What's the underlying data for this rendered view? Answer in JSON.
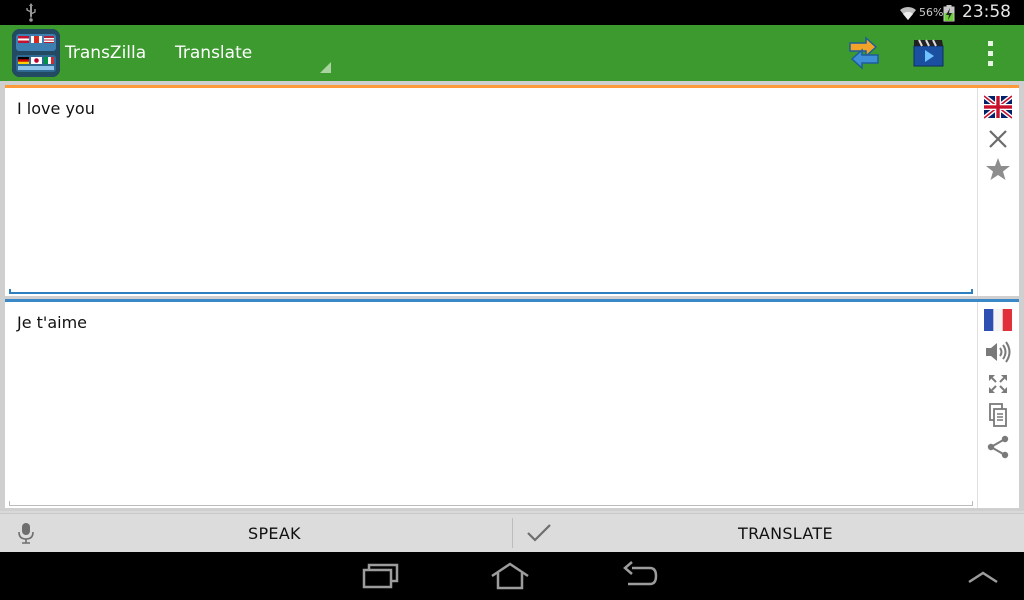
{
  "status_bar": {
    "battery_percent": "56%",
    "time": "23:58"
  },
  "action_bar": {
    "app_name": "TransZilla",
    "mode_selected": "Translate",
    "actions": [
      {
        "name": "swap-languages-icon"
      },
      {
        "name": "video-icon"
      },
      {
        "name": "overflow-menu-icon"
      }
    ]
  },
  "source": {
    "text": "I love you",
    "language_flag": "uk-flag-icon",
    "icons": [
      "uk-flag-icon",
      "clear-icon",
      "favorite-star-icon"
    ]
  },
  "target": {
    "text": "Je t'aime",
    "language_flag": "france-flag-icon",
    "icons": [
      "france-flag-icon",
      "speaker-icon",
      "fullscreen-icon",
      "copy-icon",
      "share-icon"
    ]
  },
  "bottom_bar": {
    "speak_label": "SPEAK",
    "translate_label": "TRANSLATE"
  },
  "colors": {
    "action_bar": "#3c9a2f",
    "source_accent": "#ff9a3a",
    "target_accent": "#3a88c8"
  }
}
